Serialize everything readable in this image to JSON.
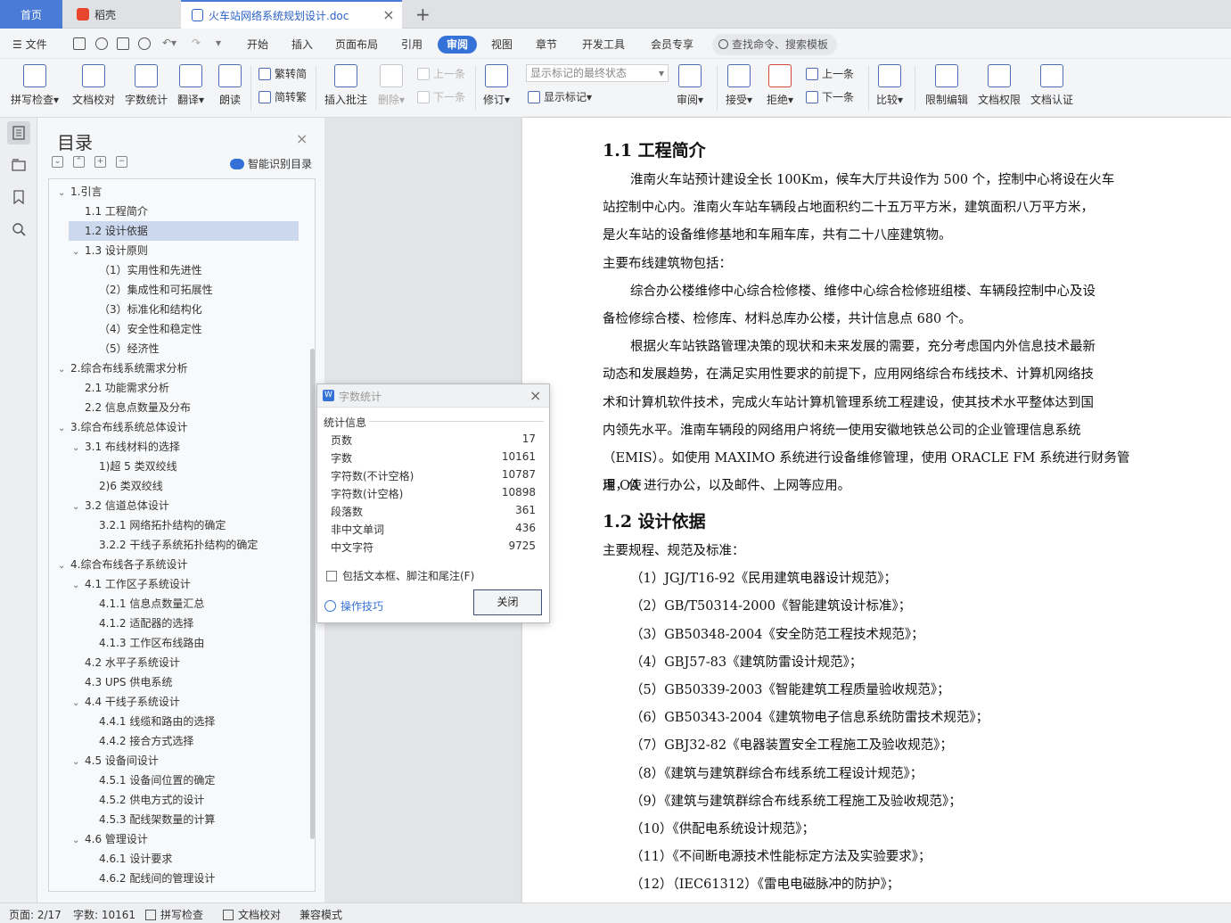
{
  "tabs": {
    "home": "首页",
    "wps": "稻壳",
    "doc": "火车站网络系统规划设计.doc"
  },
  "menu": {
    "file": "文件",
    "items": [
      "开始",
      "插入",
      "页面布局",
      "引用",
      "审阅",
      "视图",
      "章节",
      "开发工具",
      "会员专享"
    ],
    "search": "查找命令、搜索模板"
  },
  "ribbon": {
    "spell": "拼写检查",
    "proof": "文档校对",
    "wordcount": "字数统计",
    "translate": "翻译",
    "read": "朗读",
    "trad": "繁转简",
    "simp": "简转繁",
    "insert_comment": "插入批注",
    "delete": "删除",
    "prev_comment": "上一条",
    "next_comment": "下一条",
    "revise": "修订",
    "markup_dropdown": "显示标记的最终状态",
    "show_markup": "显示标记",
    "review": "审阅",
    "accept": "接受",
    "reject": "拒绝",
    "prev": "上一条",
    "next": "下一条",
    "compare": "比较",
    "restrict": "限制编辑",
    "rights": "文档权限",
    "cert": "文档认证"
  },
  "toc": {
    "title": "目录",
    "smart": "智能识别目录",
    "items": [
      {
        "label": "1.引言",
        "level": 0,
        "arrow": true
      },
      {
        "label": "1.1 工程简介",
        "level": 1,
        "arrow": false
      },
      {
        "label": "1.2 设计依据",
        "level": 1,
        "arrow": false,
        "selected": true
      },
      {
        "label": "1.3 设计原则",
        "level": 1,
        "arrow": true
      },
      {
        "label": "（1）实用性和先进性",
        "level": 2,
        "arrow": false
      },
      {
        "label": "（2）集成性和可拓展性",
        "level": 2,
        "arrow": false
      },
      {
        "label": "（3）标准化和结构化",
        "level": 2,
        "arrow": false
      },
      {
        "label": "（4）安全性和稳定性",
        "level": 2,
        "arrow": false
      },
      {
        "label": "（5）经济性",
        "level": 2,
        "arrow": false
      },
      {
        "label": "2.综合布线系统需求分析",
        "level": 0,
        "arrow": true
      },
      {
        "label": "2.1 功能需求分析",
        "level": 1,
        "arrow": false
      },
      {
        "label": "2.2 信息点数量及分布",
        "level": 1,
        "arrow": false
      },
      {
        "label": "3.综合布线系统总体设计",
        "level": 0,
        "arrow": true
      },
      {
        "label": "3.1 布线材料的选择",
        "level": 1,
        "arrow": true
      },
      {
        "label": "1)超 5 类双绞线",
        "level": 2,
        "arrow": false
      },
      {
        "label": "2)6 类双绞线",
        "level": 2,
        "arrow": false
      },
      {
        "label": "3.2 信道总体设计",
        "level": 1,
        "arrow": true
      },
      {
        "label": "3.2.1 网络拓扑结构的确定",
        "level": 2,
        "arrow": false
      },
      {
        "label": "3.2.2 干线子系统拓扑结构的确定",
        "level": 2,
        "arrow": false
      },
      {
        "label": "4.综合布线各子系统设计",
        "level": 0,
        "arrow": true
      },
      {
        "label": "4.1 工作区子系统设计",
        "level": 1,
        "arrow": true
      },
      {
        "label": "4.1.1 信息点数量汇总",
        "level": 2,
        "arrow": false
      },
      {
        "label": "4.1.2 适配器的选择",
        "level": 2,
        "arrow": false
      },
      {
        "label": "4.1.3 工作区布线路由",
        "level": 2,
        "arrow": false
      },
      {
        "label": "4.2 水平子系统设计",
        "level": 1,
        "arrow": false
      },
      {
        "label": "4.3 UPS 供电系统",
        "level": 1,
        "arrow": false
      },
      {
        "label": "4.4 干线子系统设计",
        "level": 1,
        "arrow": true
      },
      {
        "label": "4.4.1 线缆和路由的选择",
        "level": 2,
        "arrow": false
      },
      {
        "label": "4.4.2 接合方式选择",
        "level": 2,
        "arrow": false
      },
      {
        "label": "4.5 设备间设计",
        "level": 1,
        "arrow": true
      },
      {
        "label": "4.5.1 设备间位置的确定",
        "level": 2,
        "arrow": false
      },
      {
        "label": "4.5.2 供电方式的设计",
        "level": 2,
        "arrow": false
      },
      {
        "label": "4.5.3 配线架数量的计算",
        "level": 2,
        "arrow": false
      },
      {
        "label": "4.6 管理设计",
        "level": 1,
        "arrow": true
      },
      {
        "label": "4.6.1 设计要求",
        "level": 2,
        "arrow": false
      },
      {
        "label": "4.6.2 配线间的管理设计",
        "level": 2,
        "arrow": false
      }
    ]
  },
  "doc": {
    "h1": "1.1 工程简介",
    "lines1": [
      "淮南火车站预计建设全长 100Km，候车大厅共设作为 500 个，控制中心将设在火车",
      "站控制中心内。淮南火车站车辆段占地面积约二十五万平方米，建筑面积八万平方米，",
      "是火车站的设备维修基地和车厢车库，共有二十八座建筑物。",
      "主要布线建筑物包括：",
      "综合办公楼维修中心综合检修楼、维修中心综合检修班组楼、车辆段控制中心及设",
      "备检修综合楼、检修库、材料总库办公楼，共计信息点 680 个。",
      "根据火车站铁路管理决策的现状和未来发展的需要，充分考虑国内外信息技术最新",
      "动态和发展趋势，在满足实用性要求的前提下，应用网络综合布线技术、计算机网络技",
      "术和计算机软件技术，完成火车站计算机管理系统工程建设，使其技术水平整体达到国",
      "内领先水平。淮南车辆段的网络用户将统一使用安徽地铁总公司的企业管理信息系统",
      "（EMIS）。如使用 MAXIMO 系统进行设备维修管理，使用 ORACLE FM 系统进行财务管理，使",
      "用 OA 进行办公，以及邮件、上网等应用。"
    ],
    "h2": "1.2 设计依据",
    "lines2": [
      "主要规程、规范及标准：",
      "（1）JGJ/T16-92《民用建筑电器设计规范》；",
      "（2）GB/T50314-2000《智能建筑设计标准》；",
      "（3）GB50348-2004《安全防范工程技术规范》；",
      "（4）GBJ57-83《建筑防雷设计规范》；",
      "（5）GB50339-2003《智能建筑工程质量验收规范》；",
      "（6）GB50343-2004《建筑物电子信息系统防雷技术规范》；",
      "（7）GBJ32-82《电器装置安全工程施工及验收规范》；",
      "（8）《建筑与建筑群综合布线系统工程设计规范》；",
      "（9）《建筑与建筑群综合布线系统工程施工及验收规范》；",
      "（10）《供配电系统设计规范》；",
      "（11）《不间断电源技术性能标定方法及实验要求》；",
      "（12）（IEC61312）《雷电电磁脉冲的防护》；"
    ]
  },
  "dialog": {
    "title": "字数统计",
    "section": "统计信息",
    "stats": [
      {
        "k": "页数",
        "v": "17"
      },
      {
        "k": "字数",
        "v": "10161"
      },
      {
        "k": "字符数(不计空格)",
        "v": "10787"
      },
      {
        "k": "字符数(计空格)",
        "v": "10898"
      },
      {
        "k": "段落数",
        "v": "361"
      },
      {
        "k": "非中文单词",
        "v": "436"
      },
      {
        "k": "中文字符",
        "v": "9725"
      }
    ],
    "checkbox": "包括文本框、脚注和尾注(F)",
    "tip": "操作技巧",
    "close": "关闭"
  },
  "status": {
    "page": "页面: 2/17",
    "words": "字数: 10161",
    "spell": "拼写检查",
    "proof": "文档校对",
    "compat": "兼容模式"
  }
}
